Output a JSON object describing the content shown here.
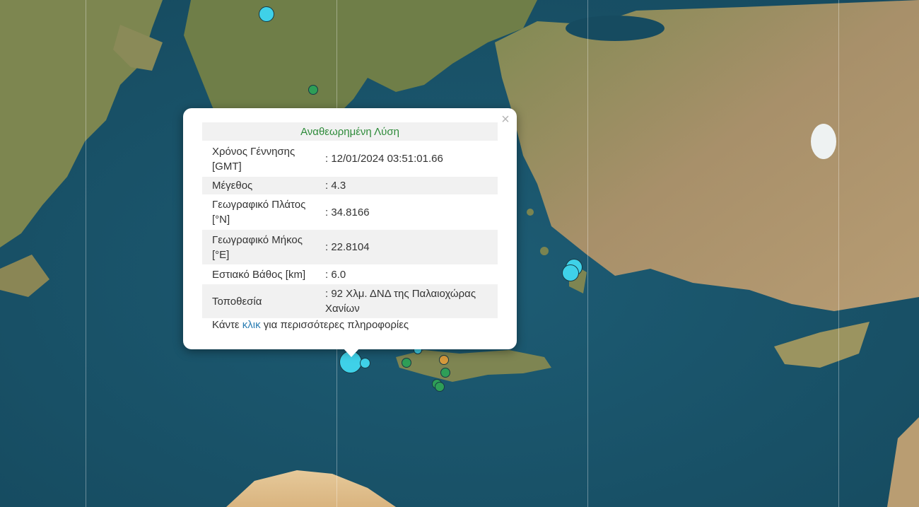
{
  "popup": {
    "title": "Αναθεωρημένη Λύση",
    "close_symbol": "×",
    "rows": [
      {
        "label": "Χρόνος Γέννησης [GMT]",
        "value": ": 12/01/2024 03:51:01.66"
      },
      {
        "label": "Μέγεθος",
        "value": ": 4.3"
      },
      {
        "label": "Γεωγραφικό Πλάτος [°N]",
        "value": ": 34.8166"
      },
      {
        "label": "Γεωγραφικό Μήκος [°E]",
        "value": ": 22.8104"
      },
      {
        "label": "Εστιακό Βάθος [km]",
        "value": ": 6.0"
      },
      {
        "label": "Τοποθεσία",
        "value": ": 92 Χλμ. ΔΝΔ της Παλαιοχώρας Χανίων"
      }
    ],
    "more_prefix": "Κάντε ",
    "more_link": "κλικ",
    "more_suffix": " για περισσότερες πληροφορίες"
  },
  "colors": {
    "sea": "#1f5f76",
    "land": "#9a8a5c",
    "marker_cyan": "#3fd1e8",
    "marker_green": "#2e9e57",
    "marker_orange": "#d79a3c",
    "title_green": "#2e8b3a",
    "link_blue": "#2a7db3"
  },
  "markers": [
    {
      "name": "earthquake-marker-selected",
      "color": "cyan",
      "size": "large"
    },
    {
      "name": "earthquake-marker",
      "color": "cyan",
      "size": "small"
    },
    {
      "name": "earthquake-marker",
      "color": "cyan",
      "size": "medium"
    },
    {
      "name": "earthquake-marker",
      "color": "cyan",
      "size": "medium"
    },
    {
      "name": "earthquake-marker",
      "color": "cyan",
      "size": "medium"
    },
    {
      "name": "earthquake-marker",
      "color": "green",
      "size": "small"
    },
    {
      "name": "earthquake-marker",
      "color": "green",
      "size": "small"
    },
    {
      "name": "earthquake-marker",
      "color": "orange",
      "size": "small"
    },
    {
      "name": "earthquake-marker",
      "color": "green",
      "size": "small"
    },
    {
      "name": "earthquake-marker",
      "color": "green",
      "size": "small"
    },
    {
      "name": "earthquake-marker",
      "color": "green",
      "size": "small"
    },
    {
      "name": "earthquake-marker",
      "color": "cyan",
      "size": "small"
    }
  ]
}
